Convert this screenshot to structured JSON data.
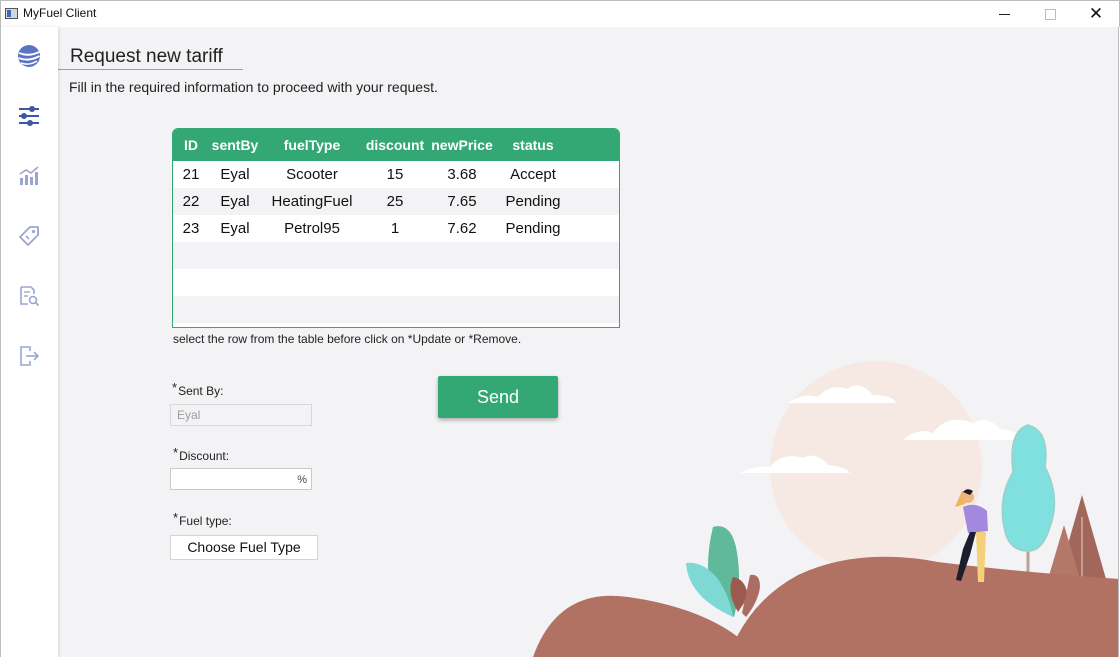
{
  "window": {
    "title": "MyFuel Client",
    "close_glyph": "✕"
  },
  "sidebar": {
    "items": [
      {
        "icon": "globe-icon"
      },
      {
        "icon": "sliders-icon"
      },
      {
        "icon": "chart-icon"
      },
      {
        "icon": "tag-icon"
      },
      {
        "icon": "search-document-icon"
      },
      {
        "icon": "logout-icon"
      }
    ]
  },
  "page": {
    "title": "Request new tariff",
    "subtitle": "Fill in the required information to proceed with your request."
  },
  "table": {
    "columns": [
      "ID",
      "sentBy",
      "fuelType",
      "discount",
      "newPrice",
      "status"
    ],
    "rows": [
      [
        "21",
        "Eyal",
        "Scooter",
        "15",
        "3.68",
        "Accept"
      ],
      [
        "22",
        "Eyal",
        "HeatingFuel",
        "25",
        "7.65",
        "Pending"
      ],
      [
        "23",
        "Eyal",
        "Petrol95",
        "1",
        "7.62",
        "Pending"
      ]
    ],
    "hint": "select the row from the table before click on *Update or *Remove."
  },
  "form": {
    "sent_by": {
      "label": "Sent By:",
      "placeholder": "Eyal"
    },
    "discount": {
      "label": "Discount:",
      "value": "",
      "unit": "%"
    },
    "fuel_type": {
      "label": "Fuel type:",
      "button_label": "Choose Fuel Type"
    },
    "required_mark": "*"
  },
  "actions": {
    "send_label": "Send"
  },
  "colors": {
    "accent": "#34a874",
    "nav_icon": "#3d56a6"
  }
}
